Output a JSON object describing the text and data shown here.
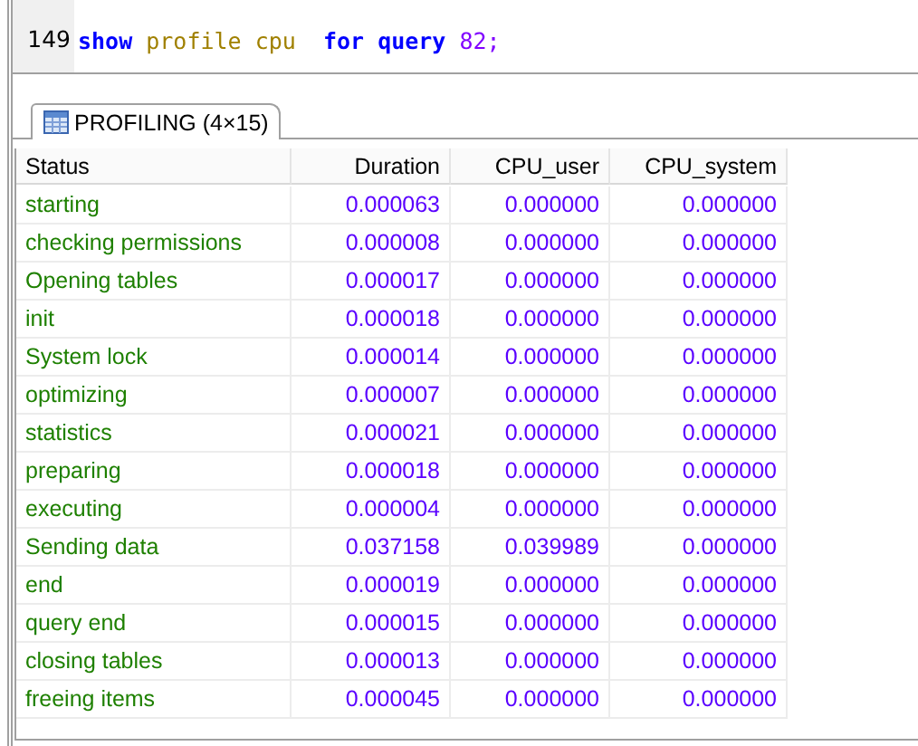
{
  "editor": {
    "lines": [
      {
        "number": "149",
        "tokens": [
          {
            "text": "show",
            "kind": "keyword"
          },
          {
            "text": " profile cpu  ",
            "kind": "function"
          },
          {
            "text": "for query",
            "kind": "keyword"
          },
          {
            "text": " 82;",
            "kind": "number"
          }
        ]
      }
    ]
  },
  "result_tab": {
    "label": "PROFILING (4×15)",
    "selected": true
  },
  "table": {
    "columns": [
      "Status",
      "Duration",
      "CPU_user",
      "CPU_system"
    ],
    "rows": [
      [
        "starting",
        "0.000063",
        "0.000000",
        "0.000000"
      ],
      [
        "checking permissions",
        "0.000008",
        "0.000000",
        "0.000000"
      ],
      [
        "Opening tables",
        "0.000017",
        "0.000000",
        "0.000000"
      ],
      [
        "init",
        "0.000018",
        "0.000000",
        "0.000000"
      ],
      [
        "System lock",
        "0.000014",
        "0.000000",
        "0.000000"
      ],
      [
        "optimizing",
        "0.000007",
        "0.000000",
        "0.000000"
      ],
      [
        "statistics",
        "0.000021",
        "0.000000",
        "0.000000"
      ],
      [
        "preparing",
        "0.000018",
        "0.000000",
        "0.000000"
      ],
      [
        "executing",
        "0.000004",
        "0.000000",
        "0.000000"
      ],
      [
        "Sending data",
        "0.037158",
        "0.039989",
        "0.000000"
      ],
      [
        "end",
        "0.000019",
        "0.000000",
        "0.000000"
      ],
      [
        "query end",
        "0.000015",
        "0.000000",
        "0.000000"
      ],
      [
        "closing tables",
        "0.000013",
        "0.000000",
        "0.000000"
      ],
      [
        "freeing items",
        "0.000045",
        "0.000000",
        "0.000000"
      ]
    ]
  }
}
